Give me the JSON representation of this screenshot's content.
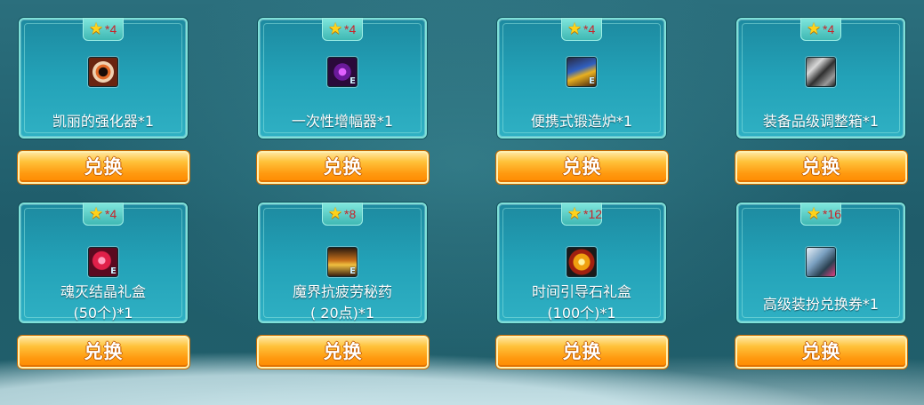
{
  "exchange": {
    "button_label": "兑换",
    "items": [
      {
        "cost": "*4",
        "name_lines": [
          "凯丽的强化器*1"
        ],
        "icon": "enhancer-disc-icon"
      },
      {
        "cost": "*4",
        "name_lines": [
          "一次性增幅器*1"
        ],
        "icon": "amplifier-orb-icon"
      },
      {
        "cost": "*4",
        "name_lines": [
          "便携式锻造炉*1"
        ],
        "icon": "forge-furnace-icon"
      },
      {
        "cost": "*4",
        "name_lines": [
          "装备品级调整箱*1"
        ],
        "icon": "grade-box-icon"
      },
      {
        "cost": "*4",
        "name_lines": [
          "魂灭结晶礼盒",
          "(50个)*1"
        ],
        "icon": "soul-crystal-icon"
      },
      {
        "cost": "*8",
        "name_lines": [
          "魔界抗疲劳秘药",
          "( 20点)*1"
        ],
        "icon": "fatigue-potion-icon"
      },
      {
        "cost": "*12",
        "name_lines": [
          "时间引导石礼盒",
          "(100个)*1"
        ],
        "icon": "time-stone-icon"
      },
      {
        "cost": "*16",
        "name_lines": [
          "高级装扮兑换券*1"
        ],
        "icon": "costume-ticket-icon"
      }
    ]
  },
  "colors": {
    "accent_orange": "#ff9a10",
    "card_teal": "#23a2b8",
    "cost_red": "#c8232a",
    "star_gold": "#ffd21a"
  }
}
